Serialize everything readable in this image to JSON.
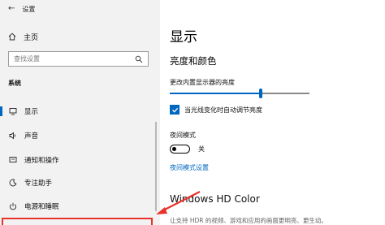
{
  "window": {
    "title": "设置"
  },
  "sidebar": {
    "home_label": "主页",
    "search_placeholder": "查找设置",
    "section_label": "系统",
    "items": [
      {
        "label": "显示",
        "icon": "monitor-icon",
        "active": true
      },
      {
        "label": "声音",
        "icon": "speaker-icon",
        "active": false
      },
      {
        "label": "通知和操作",
        "icon": "notification-icon",
        "active": false
      },
      {
        "label": "专注助手",
        "icon": "moon-icon",
        "active": false
      },
      {
        "label": "电源和睡眠",
        "icon": "power-icon",
        "active": false
      }
    ]
  },
  "main": {
    "title": "显示",
    "brightness_heading": "亮度和颜色",
    "brightness_label": "更改内置显示器的亮度",
    "brightness_value": 0.65,
    "auto_brightness_label": "当光线变化时自动调节亮度",
    "auto_brightness_checked": true,
    "night_light_label": "夜间模式",
    "night_light_state": "关",
    "night_light_settings_link": "夜间模式设置",
    "hd_color_heading": "Windows HD Color",
    "hd_color_desc": "让支持 HDR 的视频、游戏和应用的画面更明亮、更生动。"
  },
  "colors": {
    "accent": "#0067c0",
    "highlight": "#e8322b",
    "sidebar_bg": "#f2f2f2"
  }
}
